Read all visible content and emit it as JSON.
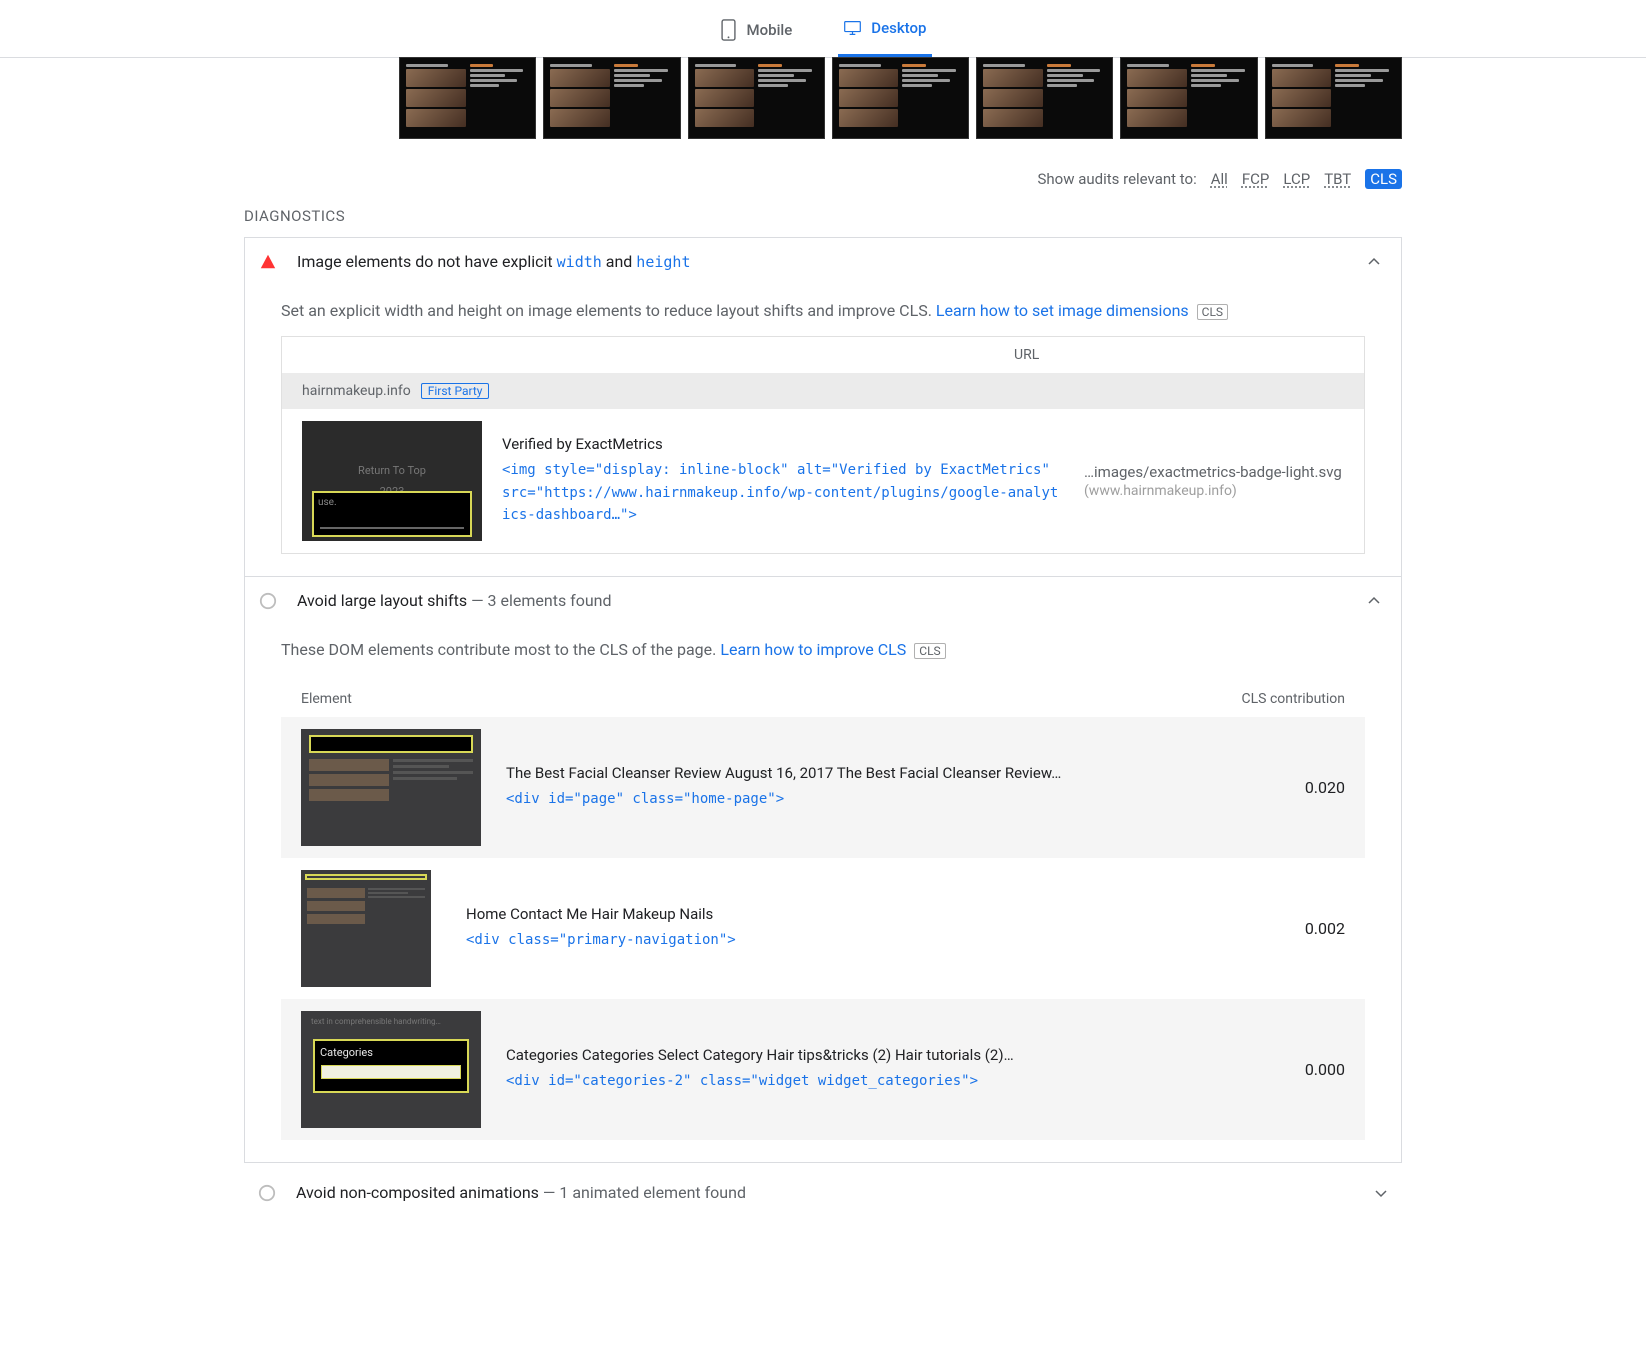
{
  "tabs": {
    "mobile": "Mobile",
    "desktop": "Desktop",
    "active": "desktop"
  },
  "filter": {
    "label": "Show audits relevant to:",
    "options": [
      "All",
      "FCP",
      "LCP",
      "TBT",
      "CLS"
    ],
    "active": "CLS"
  },
  "section_label": "DIAGNOSTICS",
  "audit1": {
    "title_pre": "Image elements do not have explicit ",
    "code1": "width",
    "mid": " and ",
    "code2": "height",
    "desc_pre": "Set an explicit width and height on image elements to reduce layout shifts and improve CLS. ",
    "desc_link": "Learn how to set image dimensions",
    "badge": "CLS",
    "col_url": "URL",
    "group_domain": "hairnmakeup.info",
    "first_party": "First Party",
    "item": {
      "label": "Verified by ExactMetrics",
      "snippet": "<img style=\"display: inline-block\" alt=\"Verified by ExactMetrics\" src=\"https://www.hairnmakeup.info/wp-content/plugins/google-analytics-dashboard…\">",
      "url_short": "…images/exactmetrics-badge-light.svg",
      "url_host": "(www.hairnmakeup.info)",
      "thumb_text1": "Return To Top",
      "thumb_text2": "2023",
      "thumb_text3": "use."
    }
  },
  "audit2": {
    "title": "Avoid large layout shifts",
    "dash": "   —   ",
    "sub": "3 elements found",
    "desc_pre": "These DOM elements contribute most to the CLS of the page. ",
    "desc_link": "Learn how to improve CLS",
    "badge": "CLS",
    "col_element": "Element",
    "col_cls": "CLS contribution",
    "rows": [
      {
        "title": "The Best Facial Cleanser Review August 16, 2017 The Best Facial Cleanser Review…",
        "snippet": "<div id=\"page\" class=\"home-page\">",
        "value": "0.020"
      },
      {
        "title": "Home Contact Me Hair Makeup Nails",
        "snippet": "<div class=\"primary-navigation\">",
        "value": "0.002"
      },
      {
        "title": "Categories Categories Select Category Hair tips&tricks  (2) Hair tutorials  (2)…",
        "snippet": "<div id=\"categories-2\" class=\"widget widget_categories\">",
        "value": "0.000",
        "thumb_label": "Categories"
      }
    ]
  },
  "audit3": {
    "title": "Avoid non-composited animations",
    "dash": "   —   ",
    "sub": "1 animated element found"
  }
}
